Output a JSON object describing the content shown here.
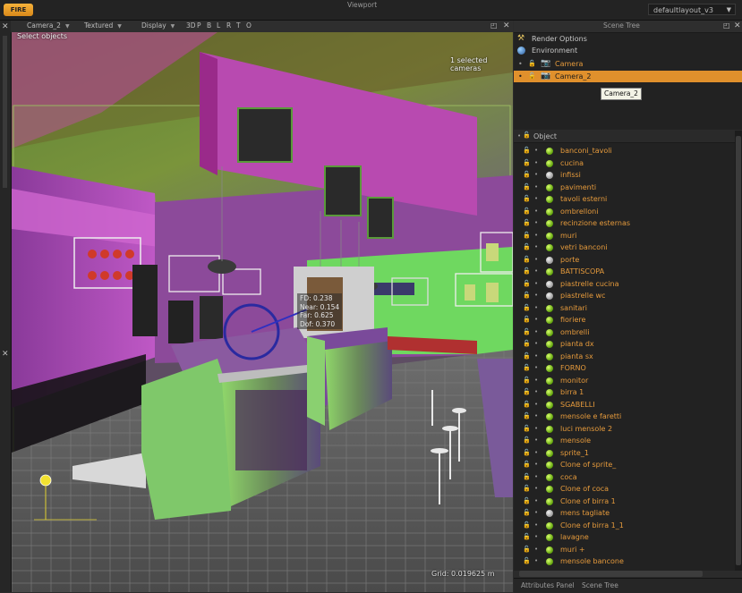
{
  "toolbar": {
    "fire_label": "FIRE",
    "layout_select": "defaultlayout_v3"
  },
  "viewport": {
    "camera_menu": "Camera_2",
    "shading_menu": "Textured",
    "display_menu": "Display",
    "view_buttons": [
      "3D",
      "P",
      "B",
      "L",
      "R",
      "T",
      "O"
    ],
    "title": "Viewport",
    "select_hint": "Select objects",
    "selection_info": "1 selected cameras",
    "grid_readout": "Grid: 0.019625 m",
    "camera_info": [
      "FD: 0.238",
      "Near: 0.154",
      "Far: 0.625",
      "Dof: 0.370"
    ]
  },
  "scene_tree": {
    "title": "Scene Tree",
    "top_items": [
      {
        "label": "Render Options",
        "icon": "render-options-icon"
      },
      {
        "label": "Environment",
        "icon": "globe-icon"
      },
      {
        "label": "Camera",
        "icon": "camera-icon",
        "selected": false
      },
      {
        "label": "Camera_2",
        "icon": "camera-icon",
        "selected": true
      }
    ],
    "tooltip": "Camera_2",
    "object_header": "Object",
    "objects": [
      {
        "name": "banconi_tavoli",
        "material": "green"
      },
      {
        "name": "cucina",
        "material": "green"
      },
      {
        "name": "infissi",
        "material": "gray"
      },
      {
        "name": "pavimenti",
        "material": "green"
      },
      {
        "name": "tavoli esterni",
        "material": "green"
      },
      {
        "name": "ombrelloni",
        "material": "green"
      },
      {
        "name": "recinzione esternas",
        "material": "green"
      },
      {
        "name": "muri",
        "material": "green"
      },
      {
        "name": "vetri banconi",
        "material": "green"
      },
      {
        "name": "porte",
        "material": "gray"
      },
      {
        "name": "BATTISCOPA",
        "material": "green"
      },
      {
        "name": "piastrelle cucina",
        "material": "gray"
      },
      {
        "name": "piastrelle wc",
        "material": "gray"
      },
      {
        "name": "sanitari",
        "material": "green"
      },
      {
        "name": "fioriere",
        "material": "green"
      },
      {
        "name": "ombrelli",
        "material": "green"
      },
      {
        "name": "pianta dx",
        "material": "green"
      },
      {
        "name": "pianta sx",
        "material": "green"
      },
      {
        "name": "FORNO",
        "material": "green"
      },
      {
        "name": "monitor",
        "material": "green"
      },
      {
        "name": "birra 1",
        "material": "green"
      },
      {
        "name": "SGABELLI",
        "material": "green"
      },
      {
        "name": "mensole e faretti",
        "material": "green"
      },
      {
        "name": "luci mensole 2",
        "material": "green"
      },
      {
        "name": "mensole",
        "material": "green"
      },
      {
        "name": "sprite_1",
        "material": "green"
      },
      {
        "name": "Clone of sprite_",
        "material": "green"
      },
      {
        "name": "coca",
        "material": "green"
      },
      {
        "name": "Clone of coca",
        "material": "green"
      },
      {
        "name": "Clone of birra 1",
        "material": "green"
      },
      {
        "name": "mens tagliate",
        "material": "gray"
      },
      {
        "name": "Clone of birra 1_1",
        "material": "green"
      },
      {
        "name": "lavagne",
        "material": "green"
      },
      {
        "name": "muri +",
        "material": "green"
      },
      {
        "name": "mensole bancone",
        "material": "green"
      }
    ]
  },
  "bottom_tabs": [
    "Attributes Panel",
    "Scene Tree"
  ],
  "colors": {
    "accent": "#e0902c",
    "object_text": "#e59a3c",
    "background": "#2b2b2b"
  }
}
